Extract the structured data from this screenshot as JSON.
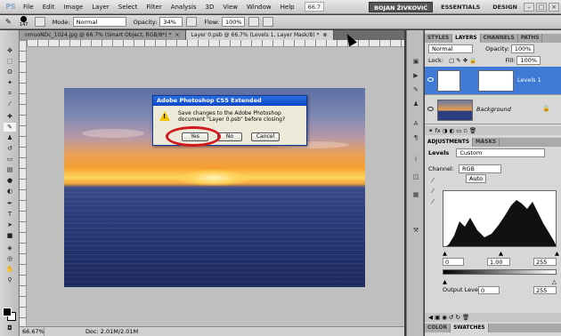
{
  "menubar": {
    "logo": "PS",
    "items": [
      "File",
      "Edit",
      "Image",
      "Layer",
      "Select",
      "Filter",
      "Analysis",
      "3D",
      "View",
      "Window",
      "Help"
    ],
    "zoom": "66.7",
    "user_workspace": "BOJAN ŽIVKOVIĆ",
    "workspaces": [
      "ESSENTIALS",
      "DESIGN"
    ]
  },
  "options": {
    "brush_size": "147",
    "mode_label": "Mode:",
    "mode_value": "Normal",
    "opacity_label": "Opacity:",
    "opacity_value": "34%",
    "flow_label": "Flow:",
    "flow_value": "100%"
  },
  "doc_tabs": [
    {
      "label": "nmuoNDc_1024.jpg @ 66.7% (Smart Object, RGB/8*) *",
      "active": false
    },
    {
      "label": "Layer 0.psb @ 66.7% (Levels 1, Layer Mask/8) *",
      "active": true
    }
  ],
  "dialog": {
    "title": "Adobe Photoshop CS5 Extended",
    "message": "Save changes to the Adobe Photoshop document \"Layer 0.psb\" before closing?",
    "yes": "Yes",
    "no": "No",
    "cancel": "Cancel"
  },
  "status": {
    "zoom": "66.67%",
    "doc": "Doc: 2.01M/2.01M"
  },
  "layers_panel": {
    "tabs": [
      "STYLES",
      "LAYERS",
      "CHANNELS",
      "PATHS"
    ],
    "active_tab": "LAYERS",
    "blend_mode": "Normal",
    "opacity_label": "Opacity:",
    "opacity_value": "100%",
    "lock_label": "Lock:",
    "fill_label": "Fill:",
    "fill_value": "100%",
    "layers": [
      {
        "name": "Levels 1",
        "selected": true
      },
      {
        "name": "Background",
        "selected": false
      }
    ]
  },
  "adjustments_panel": {
    "tabs": [
      "ADJUSTMENTS",
      "MASKS"
    ],
    "preset_label": "Levels",
    "preset_value": "Custom",
    "channel_label": "Channel:",
    "channel_value": "RGB",
    "auto_label": "Auto",
    "input_black": "0",
    "input_gamma": "1.00",
    "input_white": "255",
    "output_label": "Output Levels:",
    "output_black": "0",
    "output_white": "255"
  },
  "bottom_tabs": [
    "COLOR",
    "SWATCHES"
  ],
  "colors": {
    "dialog_title": "#0a47c8",
    "highlight_circle": "#d0181e",
    "selected_layer": "#3f7bd6"
  }
}
